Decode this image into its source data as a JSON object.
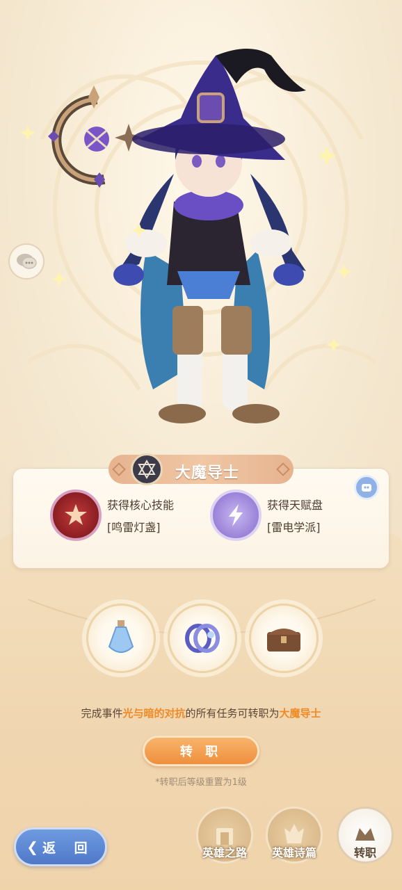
{
  "hero": {
    "class_name": "大魔导士",
    "rewards": [
      {
        "title": "获得核心技能",
        "value": "[鸣雷灯盏]",
        "icon": "skill-lantern-icon"
      },
      {
        "title": "获得天赋盘",
        "value": "[雷电学派]",
        "icon": "thunder-talent-icon"
      }
    ]
  },
  "items": [
    "potion-icon",
    "bracelet-icon",
    "chest-icon"
  ],
  "task": {
    "prefix": "完成事件",
    "event": "光与暗的对抗",
    "middle": "的所有任务可转职为",
    "target": "大魔导士"
  },
  "promote_button": "转 职",
  "note": "*转职后等级重置为1级",
  "nav": {
    "back_label": "返 回",
    "road_label": "英雄之路",
    "epic_label": "英雄诗篇",
    "promote_label": "转职"
  },
  "colors": {
    "accent_orange": "#ef8f3d",
    "highlight": "#f08a27",
    "back_blue": "#4f79c8",
    "banner": "#e6b38f"
  }
}
